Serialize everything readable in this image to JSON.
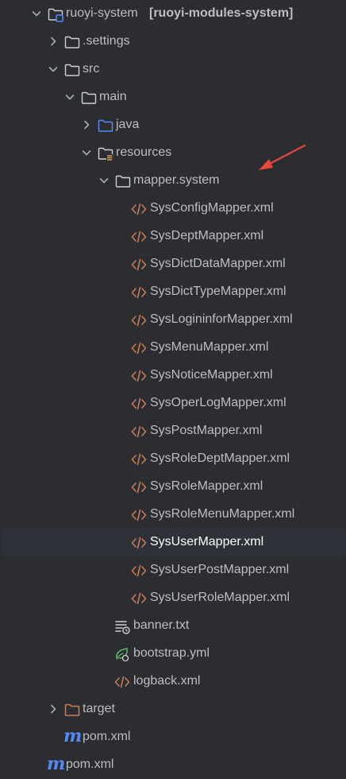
{
  "project_tree": {
    "module_name": "ruoyi-system",
    "module_artifact": "[ruoyi-modules-system]",
    "settings_folder": ".settings",
    "src_folder": "src",
    "main_folder": "main",
    "java_folder": "java",
    "resources_folder": "resources",
    "mapper_folder": "mapper.system",
    "mapper_files": [
      "SysConfigMapper.xml",
      "SysDeptMapper.xml",
      "SysDictDataMapper.xml",
      "SysDictTypeMapper.xml",
      "SysLogininforMapper.xml",
      "SysMenuMapper.xml",
      "SysNoticeMapper.xml",
      "SysOperLogMapper.xml",
      "SysPostMapper.xml",
      "SysRoleDeptMapper.xml",
      "SysRoleMapper.xml",
      "SysRoleMenuMapper.xml",
      "SysUserMapper.xml",
      "SysUserPostMapper.xml",
      "SysUserRoleMapper.xml"
    ],
    "selected_file": "SysUserMapper.xml",
    "resource_files": [
      "banner.txt",
      "bootstrap.yml",
      "logback.xml"
    ],
    "target_folder": "target",
    "module_pom": "pom.xml",
    "root_pom": "pom.xml"
  },
  "colors": {
    "background": "#2b2d30",
    "text": "#bcbec4",
    "selected_row": "#2e3138",
    "xml_icon": "#c77d55",
    "folder_icon": "#ced0d6",
    "source_folder_icon": "#548af7",
    "excluded_folder_icon": "#c77d55",
    "annotation_arrow": "#e5473d"
  }
}
